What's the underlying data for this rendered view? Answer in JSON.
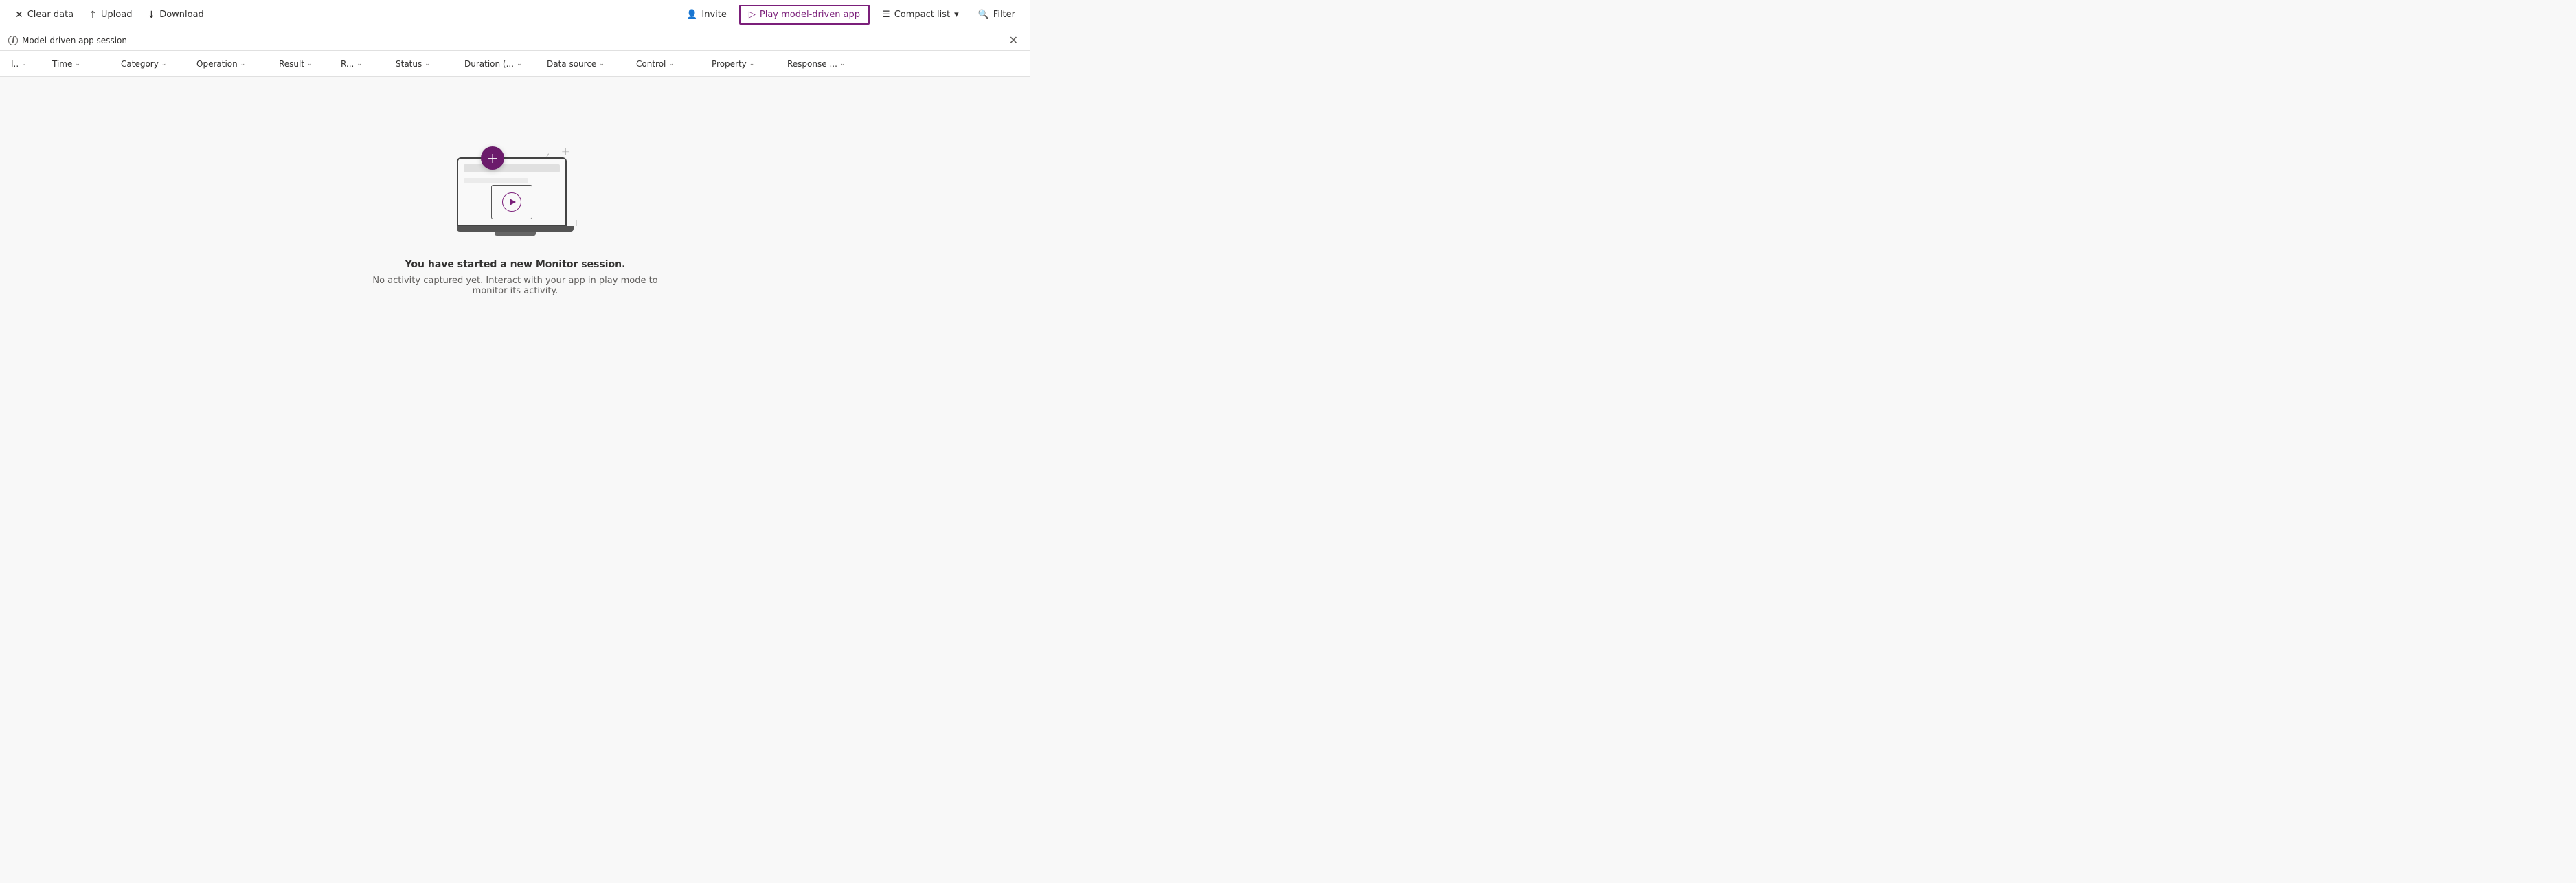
{
  "toolbar": {
    "clear_data_label": "Clear data",
    "upload_label": "Upload",
    "download_label": "Download",
    "invite_label": "Invite",
    "play_model_driven_label": "Play model-driven app",
    "compact_list_label": "Compact list",
    "filter_label": "Filter"
  },
  "session_bar": {
    "session_label": "Model-driven app session"
  },
  "columns": [
    {
      "id": "id",
      "label": "I..",
      "width": 60
    },
    {
      "id": "time",
      "label": "Time",
      "width": 100
    },
    {
      "id": "category",
      "label": "Category",
      "width": 110
    },
    {
      "id": "operation",
      "label": "Operation",
      "width": 120
    },
    {
      "id": "result",
      "label": "Result",
      "width": 90
    },
    {
      "id": "r",
      "label": "R...",
      "width": 80
    },
    {
      "id": "status",
      "label": "Status",
      "width": 100
    },
    {
      "id": "duration",
      "label": "Duration (...",
      "width": 120
    },
    {
      "id": "datasource",
      "label": "Data source",
      "width": 130
    },
    {
      "id": "control",
      "label": "Control",
      "width": 110
    },
    {
      "id": "property",
      "label": "Property",
      "width": 110
    },
    {
      "id": "response",
      "label": "Response ...",
      "width": 130
    }
  ],
  "empty_state": {
    "title": "You have started a new Monitor session.",
    "subtitle": "No activity captured yet. Interact with your app in play mode to monitor its activity."
  }
}
